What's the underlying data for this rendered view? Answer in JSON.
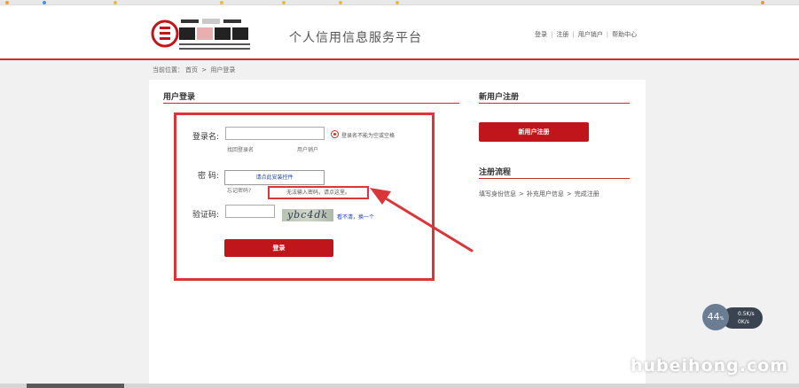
{
  "header": {
    "logo_text": "中国人民银行征信中心",
    "logo_subtitle": "CREDIT REFERENCE CENTER THE PEOPLE'S BANK OF CHINA",
    "platform_title": "个人信用信息服务平台",
    "top_links": [
      "登录",
      "注册",
      "用户销户",
      "帮助中心"
    ]
  },
  "breadcrumb": {
    "prefix": "当前位置：",
    "home": "首页",
    "separator": ">",
    "current": "用户登录"
  },
  "login": {
    "title": "用户登录",
    "username_label": "登录名:",
    "username_value": "",
    "username_hint": "登录名不能为空或空格",
    "forgot_username": "找回登录名",
    "cancel_account": "用户销户",
    "password_label": "密  码:",
    "password_control_text": "请点此安装控件",
    "forgot_password": "忘记密码?",
    "password_note": "无法输入密码，请点这里。",
    "captcha_label": "验证码:",
    "captcha_value": "",
    "captcha_image_text": "ybc4dk",
    "captcha_refresh": "看不清，换一个",
    "submit_label": "登录"
  },
  "register": {
    "title": "新用户注册",
    "button_label": "新用户注册",
    "flow_title": "注册流程",
    "flow_steps": [
      "填写身份信息",
      "补充用户信息",
      "完成注册"
    ],
    "flow_separator": ">"
  },
  "speed_widget": {
    "percent": "44",
    "percent_unit": "%",
    "up_speed": "0.5K/s",
    "down_speed": "0K/s"
  },
  "watermark": "hubeihong.com",
  "colors": {
    "brand_red": "#c0161b",
    "annotation_red": "#d9353a",
    "link_blue": "#1a3fb0"
  }
}
